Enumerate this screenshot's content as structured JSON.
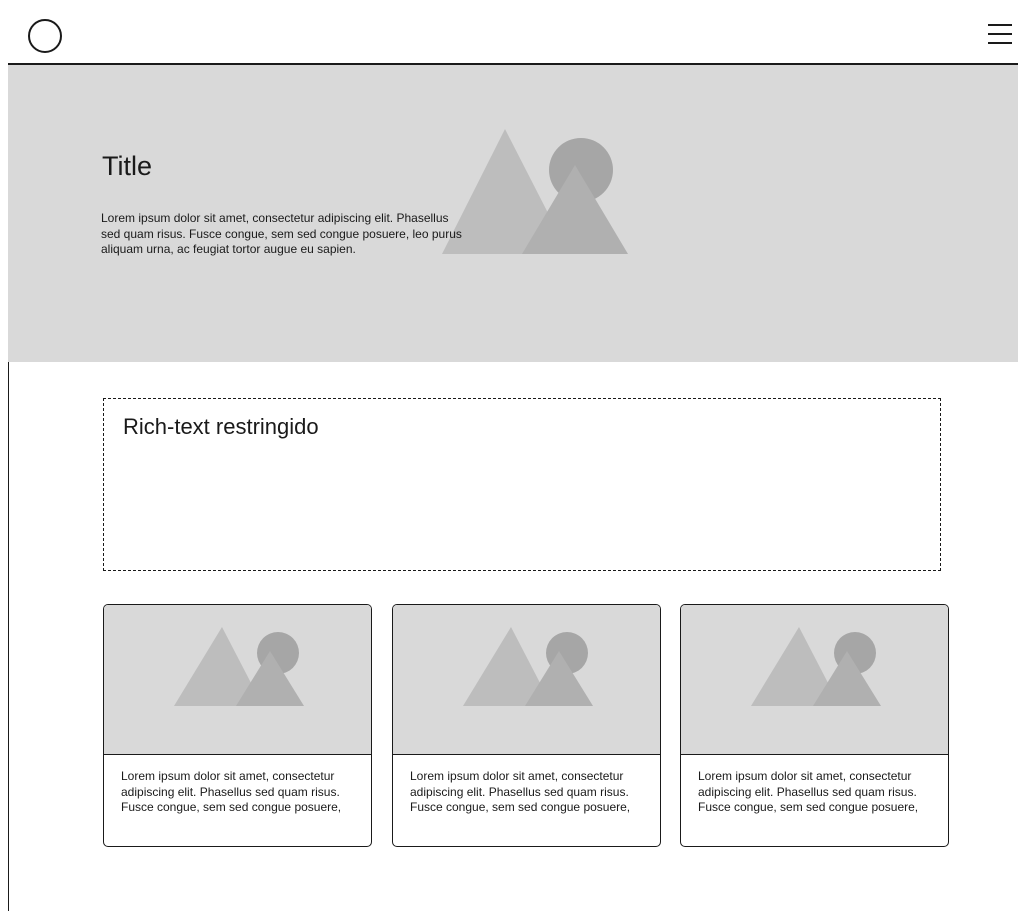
{
  "header": {
    "logo_icon": "circle-logo-icon",
    "menu_icon": "hamburger-menu-icon"
  },
  "hero": {
    "title": "Title",
    "text": "Lorem ipsum dolor sit amet, consectetur adipiscing elit. Phasellus sed quam risus. Fusce congue, sem sed congue posuere, leo purus aliquam urna, ac feugiat tortor augue eu sapien.",
    "image_icon": "image-placeholder-icon",
    "background_color": "#d9d9d9"
  },
  "richtext": {
    "title": "Rich-text restringido"
  },
  "cards": [
    {
      "text": "Lorem ipsum dolor sit amet, consectetur adipiscing elit. Phasellus sed quam risus. Fusce congue, sem sed congue posuere,",
      "image_icon": "image-placeholder-icon"
    },
    {
      "text": "Lorem ipsum dolor sit amet, consectetur adipiscing elit. Phasellus sed quam risus. Fusce congue, sem sed congue posuere,",
      "image_icon": "image-placeholder-icon"
    },
    {
      "text": "Lorem ipsum dolor sit amet, consectetur adipiscing elit. Phasellus sed quam risus. Fusce congue, sem sed congue posuere,",
      "image_icon": "image-placeholder-icon"
    }
  ]
}
